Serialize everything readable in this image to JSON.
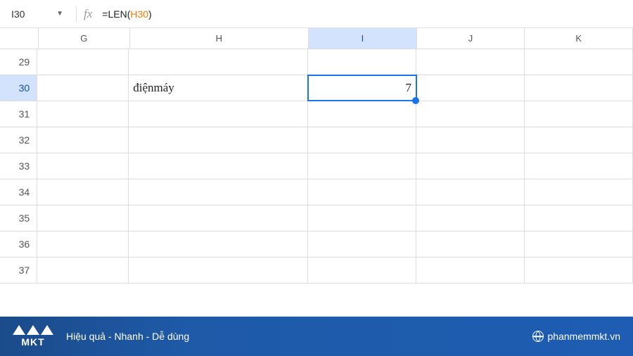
{
  "nameBox": "I30",
  "fxLabel": "fx",
  "formula": {
    "prefix": "=LEN(",
    "ref": "H30",
    "suffix": ")"
  },
  "columns": [
    "G",
    "H",
    "I",
    "J",
    "K"
  ],
  "selectedColumn": "I",
  "rows": [
    29,
    30,
    31,
    32,
    33,
    34,
    35,
    36,
    37
  ],
  "selectedRow": 30,
  "cells": {
    "H30": "điệnmáy",
    "I30": "7"
  },
  "activeCell": "I30",
  "footer": {
    "logoText": "MKT",
    "tagline": "Hiệu quả - Nhanh  - Dễ dùng",
    "site": "phanmemmkt.vn"
  }
}
